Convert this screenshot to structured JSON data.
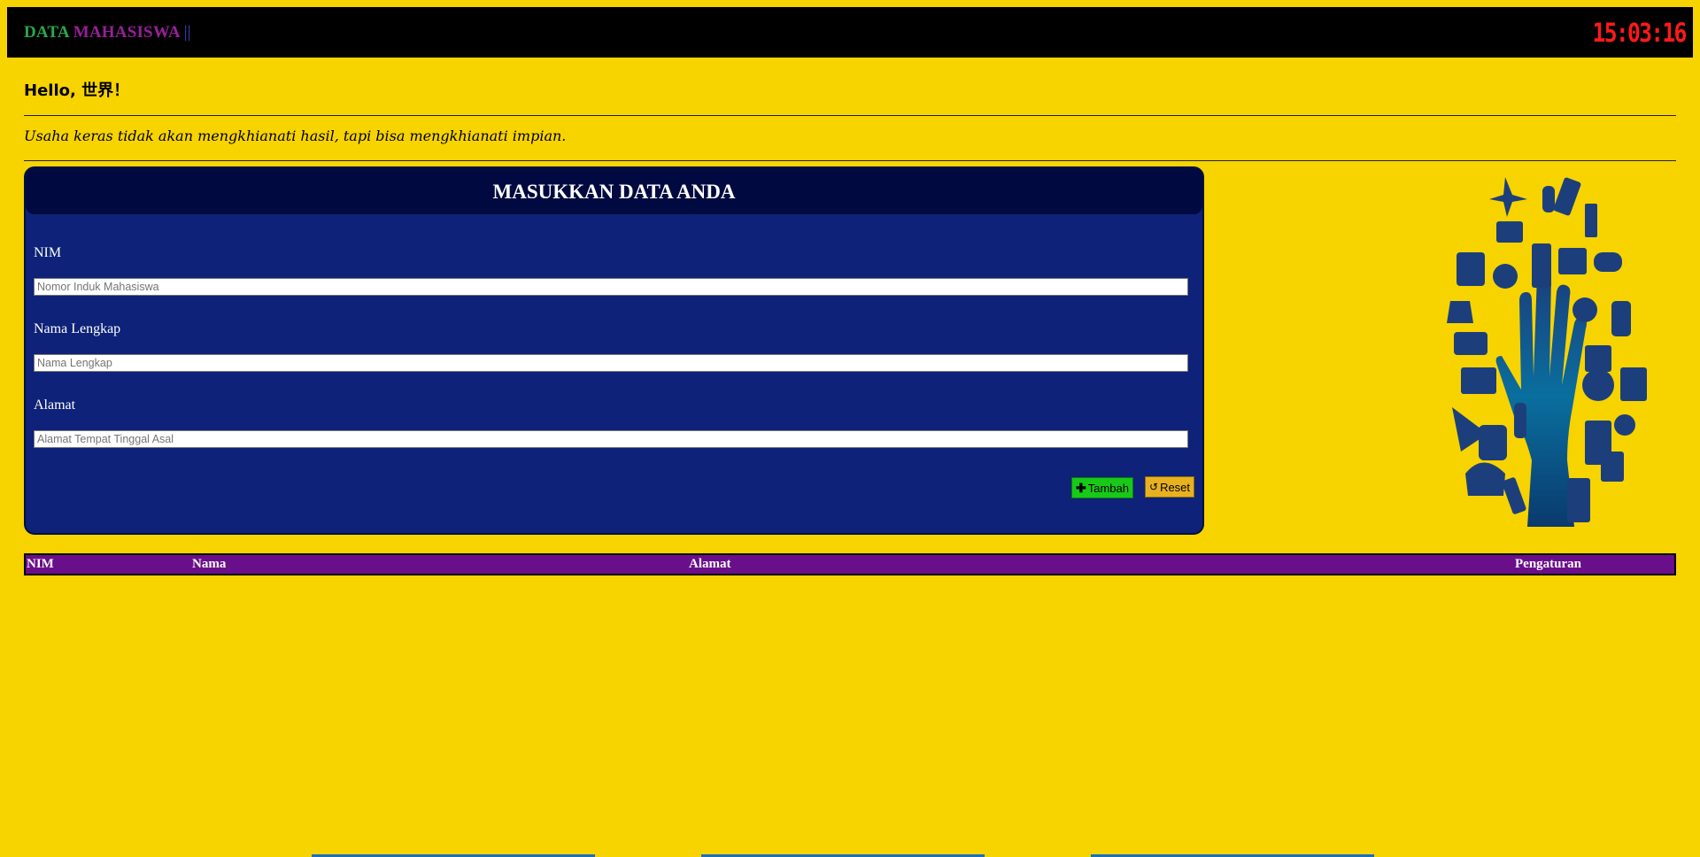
{
  "header": {
    "brand_part1": "DATA",
    "brand_part2": "MAHASISWA",
    "brand_part3": "||",
    "clock": "15:03:16"
  },
  "greeting": "Hello, 世界！",
  "quote": "Usaha keras tidak akan mengkhianati hasil, tapi bisa mengkhianati impian.",
  "form": {
    "title": "MASUKKAN DATA ANDA",
    "fields": [
      {
        "label": "NIM",
        "placeholder": "Nomor Induk Mahasiswa",
        "value": ""
      },
      {
        "label": "Nama Lengkap",
        "placeholder": "Nama Lengkap",
        "value": ""
      },
      {
        "label": "Alamat",
        "placeholder": "Alamat Tempat Tinggal Asal",
        "value": ""
      }
    ],
    "add_label": "Tambah",
    "add_icon": "plus-icon",
    "reset_label": "Reset",
    "reset_icon": "refresh-icon"
  },
  "table": {
    "columns": [
      "NIM",
      "Nama",
      "Alamat",
      "Pengaturan"
    ],
    "rows": []
  },
  "colors": {
    "background": "#f7d300",
    "topbar": "#000000",
    "clock": "#ff1a1a",
    "form_body": "#0d2278",
    "form_header": "#000a40",
    "table_header": "#6a0f8a",
    "button_add": "#18c918",
    "button_reset": "#e8b21f"
  }
}
